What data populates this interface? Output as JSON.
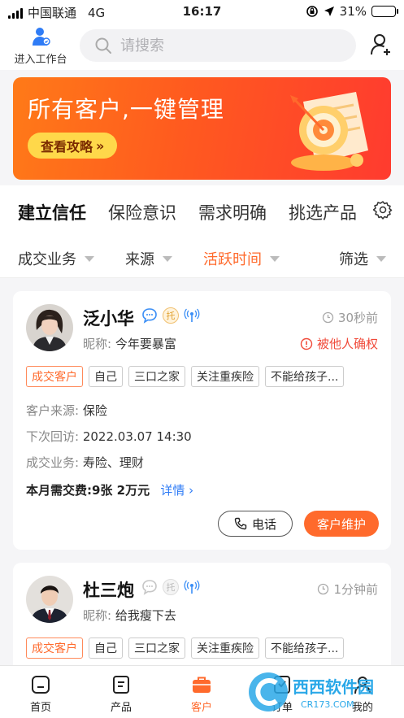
{
  "status_bar": {
    "carrier": "中国联通",
    "network": "4G",
    "time": "16:17",
    "battery": "31%",
    "battery_level": 0.31
  },
  "header": {
    "workbench_label": "进入工作台",
    "search_placeholder": "请搜索"
  },
  "banner": {
    "title": "所有客户,一键管理",
    "button_label": "查看攻略"
  },
  "tabs": [
    {
      "label": "建立信任",
      "active": true
    },
    {
      "label": "保险意识",
      "active": false
    },
    {
      "label": "需求明确",
      "active": false
    },
    {
      "label": "挑选产品",
      "active": false
    }
  ],
  "filters": [
    {
      "label": "成交业务",
      "active": false
    },
    {
      "label": "来源",
      "active": false
    },
    {
      "label": "活跃时间",
      "active": true
    },
    {
      "label": "筛选",
      "active": false
    }
  ],
  "customers": [
    {
      "name": "泛小华",
      "time_ago": "30秒前",
      "nickname_label": "昵称:",
      "nickname": "今年要暴富",
      "claimed": "被他人确权",
      "tags": [
        "成交客户",
        "自己",
        "三口之家",
        "关注重疾险",
        "不能给孩子..."
      ],
      "source_label": "客户来源:",
      "source": "保险",
      "visit_label": "下次回访:",
      "visit": "2022.03.07 14:30",
      "business_label": "成交业务:",
      "business": "寿险、理财",
      "due": "本月需交费:9张 2万元",
      "detail_link": "详情 ›",
      "call_label": "电话",
      "maintain_label": "客户维护"
    },
    {
      "name": "杜三炮",
      "time_ago": "1分钟前",
      "nickname_label": "昵称:",
      "nickname": "给我瘦下去",
      "tags": [
        "成交客户",
        "自己",
        "三口之家",
        "关注重疾险",
        "不能给孩子..."
      ]
    }
  ],
  "badges": {
    "tuo": "托"
  },
  "bottom_nav": [
    {
      "label": "首页",
      "icon": "home-icon",
      "active": false
    },
    {
      "label": "产品",
      "icon": "product-icon",
      "active": false
    },
    {
      "label": "客户",
      "icon": "briefcase-icon",
      "active": true
    },
    {
      "label": "订单",
      "icon": "order-icon",
      "active": false
    },
    {
      "label": "我的",
      "icon": "profile-icon",
      "active": false
    }
  ],
  "watermark": {
    "brand": "西西软件园",
    "domain": "CR173.COM"
  },
  "colors": {
    "accent": "#ff6a2c",
    "link": "#2f7cf6",
    "warning": "#f04a3a",
    "banner_start": "#ff7a18",
    "banner_end": "#ff3b2f"
  }
}
